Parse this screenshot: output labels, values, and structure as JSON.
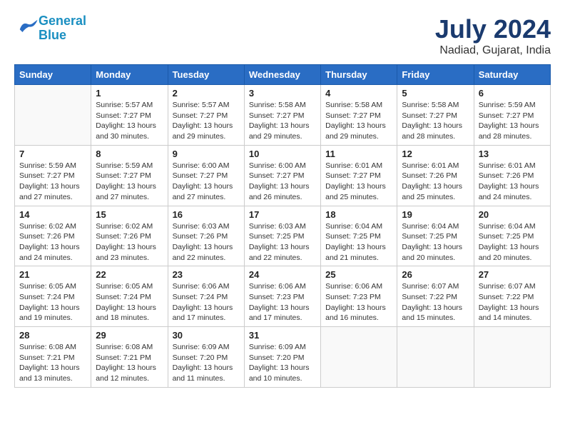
{
  "logo": {
    "line1": "General",
    "line2": "Blue"
  },
  "title": "July 2024",
  "subtitle": "Nadiad, Gujarat, India",
  "days_header": [
    "Sunday",
    "Monday",
    "Tuesday",
    "Wednesday",
    "Thursday",
    "Friday",
    "Saturday"
  ],
  "weeks": [
    [
      {
        "num": "",
        "info": ""
      },
      {
        "num": "1",
        "info": "Sunrise: 5:57 AM\nSunset: 7:27 PM\nDaylight: 13 hours\nand 30 minutes."
      },
      {
        "num": "2",
        "info": "Sunrise: 5:57 AM\nSunset: 7:27 PM\nDaylight: 13 hours\nand 29 minutes."
      },
      {
        "num": "3",
        "info": "Sunrise: 5:58 AM\nSunset: 7:27 PM\nDaylight: 13 hours\nand 29 minutes."
      },
      {
        "num": "4",
        "info": "Sunrise: 5:58 AM\nSunset: 7:27 PM\nDaylight: 13 hours\nand 29 minutes."
      },
      {
        "num": "5",
        "info": "Sunrise: 5:58 AM\nSunset: 7:27 PM\nDaylight: 13 hours\nand 28 minutes."
      },
      {
        "num": "6",
        "info": "Sunrise: 5:59 AM\nSunset: 7:27 PM\nDaylight: 13 hours\nand 28 minutes."
      }
    ],
    [
      {
        "num": "7",
        "info": "Sunrise: 5:59 AM\nSunset: 7:27 PM\nDaylight: 13 hours\nand 27 minutes."
      },
      {
        "num": "8",
        "info": "Sunrise: 5:59 AM\nSunset: 7:27 PM\nDaylight: 13 hours\nand 27 minutes."
      },
      {
        "num": "9",
        "info": "Sunrise: 6:00 AM\nSunset: 7:27 PM\nDaylight: 13 hours\nand 27 minutes."
      },
      {
        "num": "10",
        "info": "Sunrise: 6:00 AM\nSunset: 7:27 PM\nDaylight: 13 hours\nand 26 minutes."
      },
      {
        "num": "11",
        "info": "Sunrise: 6:01 AM\nSunset: 7:27 PM\nDaylight: 13 hours\nand 25 minutes."
      },
      {
        "num": "12",
        "info": "Sunrise: 6:01 AM\nSunset: 7:26 PM\nDaylight: 13 hours\nand 25 minutes."
      },
      {
        "num": "13",
        "info": "Sunrise: 6:01 AM\nSunset: 7:26 PM\nDaylight: 13 hours\nand 24 minutes."
      }
    ],
    [
      {
        "num": "14",
        "info": "Sunrise: 6:02 AM\nSunset: 7:26 PM\nDaylight: 13 hours\nand 24 minutes."
      },
      {
        "num": "15",
        "info": "Sunrise: 6:02 AM\nSunset: 7:26 PM\nDaylight: 13 hours\nand 23 minutes."
      },
      {
        "num": "16",
        "info": "Sunrise: 6:03 AM\nSunset: 7:26 PM\nDaylight: 13 hours\nand 22 minutes."
      },
      {
        "num": "17",
        "info": "Sunrise: 6:03 AM\nSunset: 7:25 PM\nDaylight: 13 hours\nand 22 minutes."
      },
      {
        "num": "18",
        "info": "Sunrise: 6:04 AM\nSunset: 7:25 PM\nDaylight: 13 hours\nand 21 minutes."
      },
      {
        "num": "19",
        "info": "Sunrise: 6:04 AM\nSunset: 7:25 PM\nDaylight: 13 hours\nand 20 minutes."
      },
      {
        "num": "20",
        "info": "Sunrise: 6:04 AM\nSunset: 7:25 PM\nDaylight: 13 hours\nand 20 minutes."
      }
    ],
    [
      {
        "num": "21",
        "info": "Sunrise: 6:05 AM\nSunset: 7:24 PM\nDaylight: 13 hours\nand 19 minutes."
      },
      {
        "num": "22",
        "info": "Sunrise: 6:05 AM\nSunset: 7:24 PM\nDaylight: 13 hours\nand 18 minutes."
      },
      {
        "num": "23",
        "info": "Sunrise: 6:06 AM\nSunset: 7:24 PM\nDaylight: 13 hours\nand 17 minutes."
      },
      {
        "num": "24",
        "info": "Sunrise: 6:06 AM\nSunset: 7:23 PM\nDaylight: 13 hours\nand 17 minutes."
      },
      {
        "num": "25",
        "info": "Sunrise: 6:06 AM\nSunset: 7:23 PM\nDaylight: 13 hours\nand 16 minutes."
      },
      {
        "num": "26",
        "info": "Sunrise: 6:07 AM\nSunset: 7:22 PM\nDaylight: 13 hours\nand 15 minutes."
      },
      {
        "num": "27",
        "info": "Sunrise: 6:07 AM\nSunset: 7:22 PM\nDaylight: 13 hours\nand 14 minutes."
      }
    ],
    [
      {
        "num": "28",
        "info": "Sunrise: 6:08 AM\nSunset: 7:21 PM\nDaylight: 13 hours\nand 13 minutes."
      },
      {
        "num": "29",
        "info": "Sunrise: 6:08 AM\nSunset: 7:21 PM\nDaylight: 13 hours\nand 12 minutes."
      },
      {
        "num": "30",
        "info": "Sunrise: 6:09 AM\nSunset: 7:20 PM\nDaylight: 13 hours\nand 11 minutes."
      },
      {
        "num": "31",
        "info": "Sunrise: 6:09 AM\nSunset: 7:20 PM\nDaylight: 13 hours\nand 10 minutes."
      },
      {
        "num": "",
        "info": ""
      },
      {
        "num": "",
        "info": ""
      },
      {
        "num": "",
        "info": ""
      }
    ]
  ]
}
